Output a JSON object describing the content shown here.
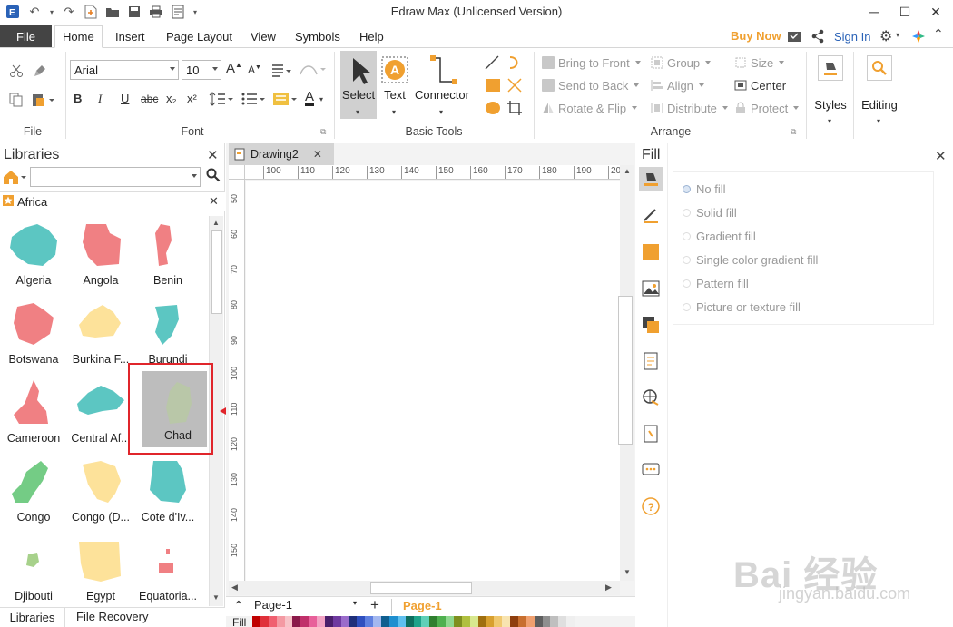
{
  "app": {
    "title": "Edraw Max (Unlicensed Version)"
  },
  "window": {
    "minimize": "─",
    "maximize": "☐",
    "close": "✕"
  },
  "menu": {
    "file": "File",
    "tabs": [
      "Home",
      "Insert",
      "Page Layout",
      "View",
      "Symbols",
      "Help"
    ],
    "buy_now": "Buy Now",
    "sign_in": "Sign In"
  },
  "ribbon": {
    "groups": {
      "file": "File",
      "font": "Font",
      "basic_tools": "Basic Tools",
      "arrange": "Arrange"
    },
    "font_name": "Arial",
    "font_size": "10",
    "font_buttons": {
      "bold": "B",
      "italic": "I",
      "underline": "U",
      "strike": "abc",
      "subscript": "x₂",
      "superscript": "x²",
      "font_color": "A"
    },
    "grow_font": "A",
    "shrink_font": "A",
    "tools": {
      "select": "Select",
      "text": "Text",
      "connector": "Connector"
    },
    "arrange": {
      "bring_to_front": "Bring to Front",
      "send_to_back": "Send to Back",
      "rotate_flip": "Rotate & Flip",
      "group": "Group",
      "align": "Align",
      "distribute": "Distribute",
      "size": "Size",
      "center": "Center",
      "protect": "Protect"
    },
    "styles": "Styles",
    "editing": "Editing"
  },
  "libraries": {
    "title": "Libraries",
    "category": "Africa",
    "shapes": [
      {
        "name": "Algeria",
        "color": "#5cc6c2"
      },
      {
        "name": "Angola",
        "color": "#f08083"
      },
      {
        "name": "Benin",
        "color": "#f08083"
      },
      {
        "name": "Botswana",
        "color": "#f08083"
      },
      {
        "name": "Burkina F...",
        "color": "#fde29a"
      },
      {
        "name": "Burundi",
        "color": "#5cc6c2"
      },
      {
        "name": "Cameroon",
        "color": "#f08083"
      },
      {
        "name": "Central Af...",
        "color": "#5cc6c2"
      },
      {
        "name": "Chad",
        "color": "#b9c7a8"
      },
      {
        "name": "Congo",
        "color": "#74cc85"
      },
      {
        "name": "Congo (D...",
        "color": "#fde29a"
      },
      {
        "name": "Cote d'Iv...",
        "color": "#5cc6c2"
      },
      {
        "name": "Djibouti",
        "color": "#a7d18b"
      },
      {
        "name": "Egypt",
        "color": "#fde29a"
      },
      {
        "name": "Equatoria...",
        "color": "#f08083"
      }
    ],
    "bottom_tabs": [
      "Libraries",
      "File Recovery"
    ]
  },
  "document": {
    "tab": "Drawing2",
    "ruler_h": [
      "100",
      "110",
      "120",
      "130",
      "140",
      "150",
      "160",
      "170",
      "180",
      "190",
      "20"
    ],
    "ruler_v": [
      "50",
      "60",
      "70",
      "80",
      "90",
      "100",
      "110",
      "120",
      "130",
      "140",
      "150",
      "60"
    ],
    "page_select": "Page-1",
    "page_tab": "Page-1",
    "fill_label": "Fill"
  },
  "fill_panel": {
    "title": "Fill",
    "options": [
      "No fill",
      "Solid fill",
      "Gradient fill",
      "Single color gradient fill",
      "Pattern fill",
      "Picture or texture fill"
    ],
    "selected": "No fill"
  },
  "colors": {
    "accent_orange": "#f0a030",
    "highlight_red": "#e0252b",
    "brand_blue": "#2a62b7"
  },
  "watermark": {
    "logo": "Bai 经验",
    "url": "jingyan.baidu.com"
  }
}
